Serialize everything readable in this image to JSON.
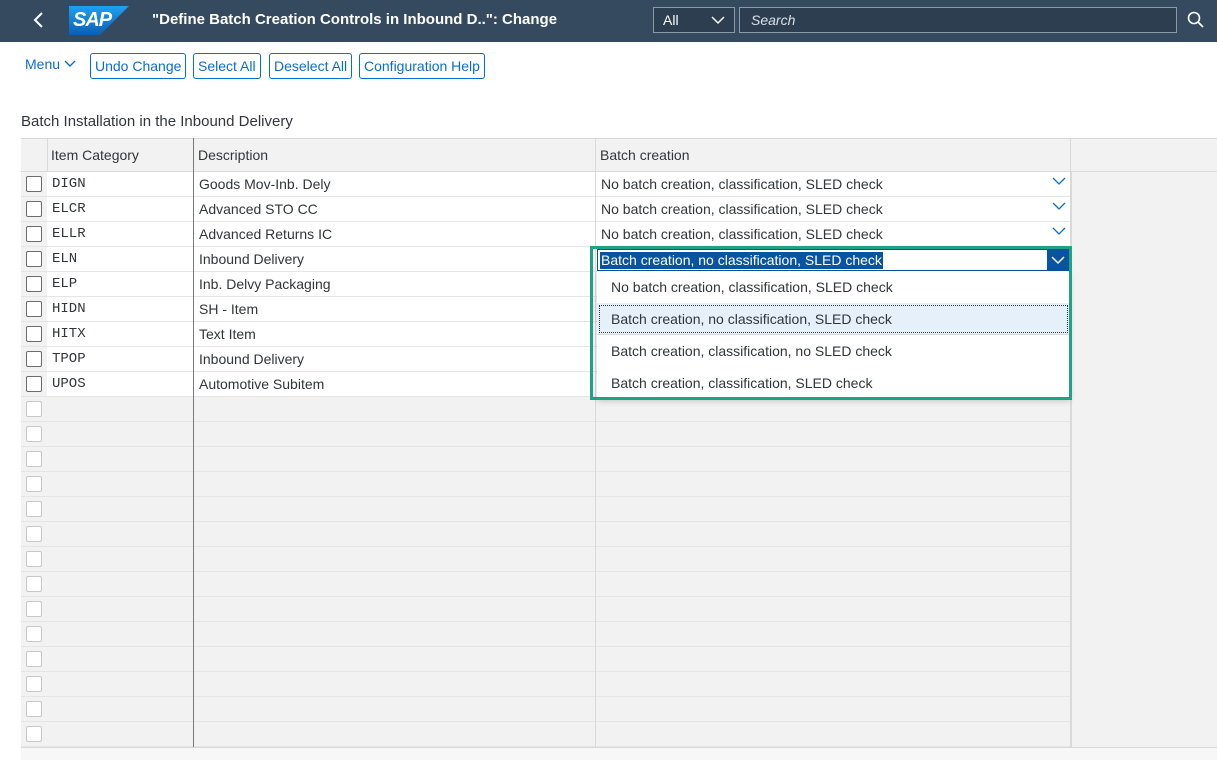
{
  "shell": {
    "title": "\"Define Batch Creation Controls in Inbound D..\": Change",
    "logo_text": "SAP",
    "scope": "All",
    "search_placeholder": "Search"
  },
  "toolbar": {
    "menu": "Menu",
    "undo": "Undo Change",
    "select_all": "Select All",
    "deselect_all": "Deselect All",
    "config_help": "Configuration Help"
  },
  "section_title": "Batch Installation in the Inbound Delivery",
  "table": {
    "headers": {
      "item_category": "Item Category",
      "description": "Description",
      "batch_creation": "Batch creation"
    },
    "rows": [
      {
        "cat": "DIGN",
        "desc": "Goods Mov-Inb. Dely",
        "batch": "No batch creation, classification, SLED check"
      },
      {
        "cat": "ELCR",
        "desc": "Advanced STO CC",
        "batch": "No batch creation, classification, SLED check"
      },
      {
        "cat": "ELLR",
        "desc": "Advanced Returns IC",
        "batch": "No batch creation, classification, SLED check"
      },
      {
        "cat": "ELN",
        "desc": "Inbound Delivery",
        "batch": ""
      },
      {
        "cat": "ELP",
        "desc": "Inb. Delvy Packaging",
        "batch": ""
      },
      {
        "cat": "HIDN",
        "desc": "SH - Item",
        "batch": ""
      },
      {
        "cat": "HITX",
        "desc": "Text Item",
        "batch": ""
      },
      {
        "cat": "TPOP",
        "desc": "Inbound Delivery",
        "batch": ""
      },
      {
        "cat": "UPOS",
        "desc": "Automotive Subitem",
        "batch": ""
      }
    ]
  },
  "dropdown": {
    "current_value": "Batch creation, no classification, SLED check",
    "options": [
      "No batch creation, classification, SLED check",
      "Batch creation, no classification, SLED check",
      "Batch creation, classification, no SLED check",
      "Batch creation, classification, SLED check"
    ],
    "selected_index": 1
  },
  "colors": {
    "shell_bg": "#354a5f",
    "accent": "#0a6ed1",
    "highlight_frame": "#1fa384",
    "selection": "#0854a0"
  }
}
